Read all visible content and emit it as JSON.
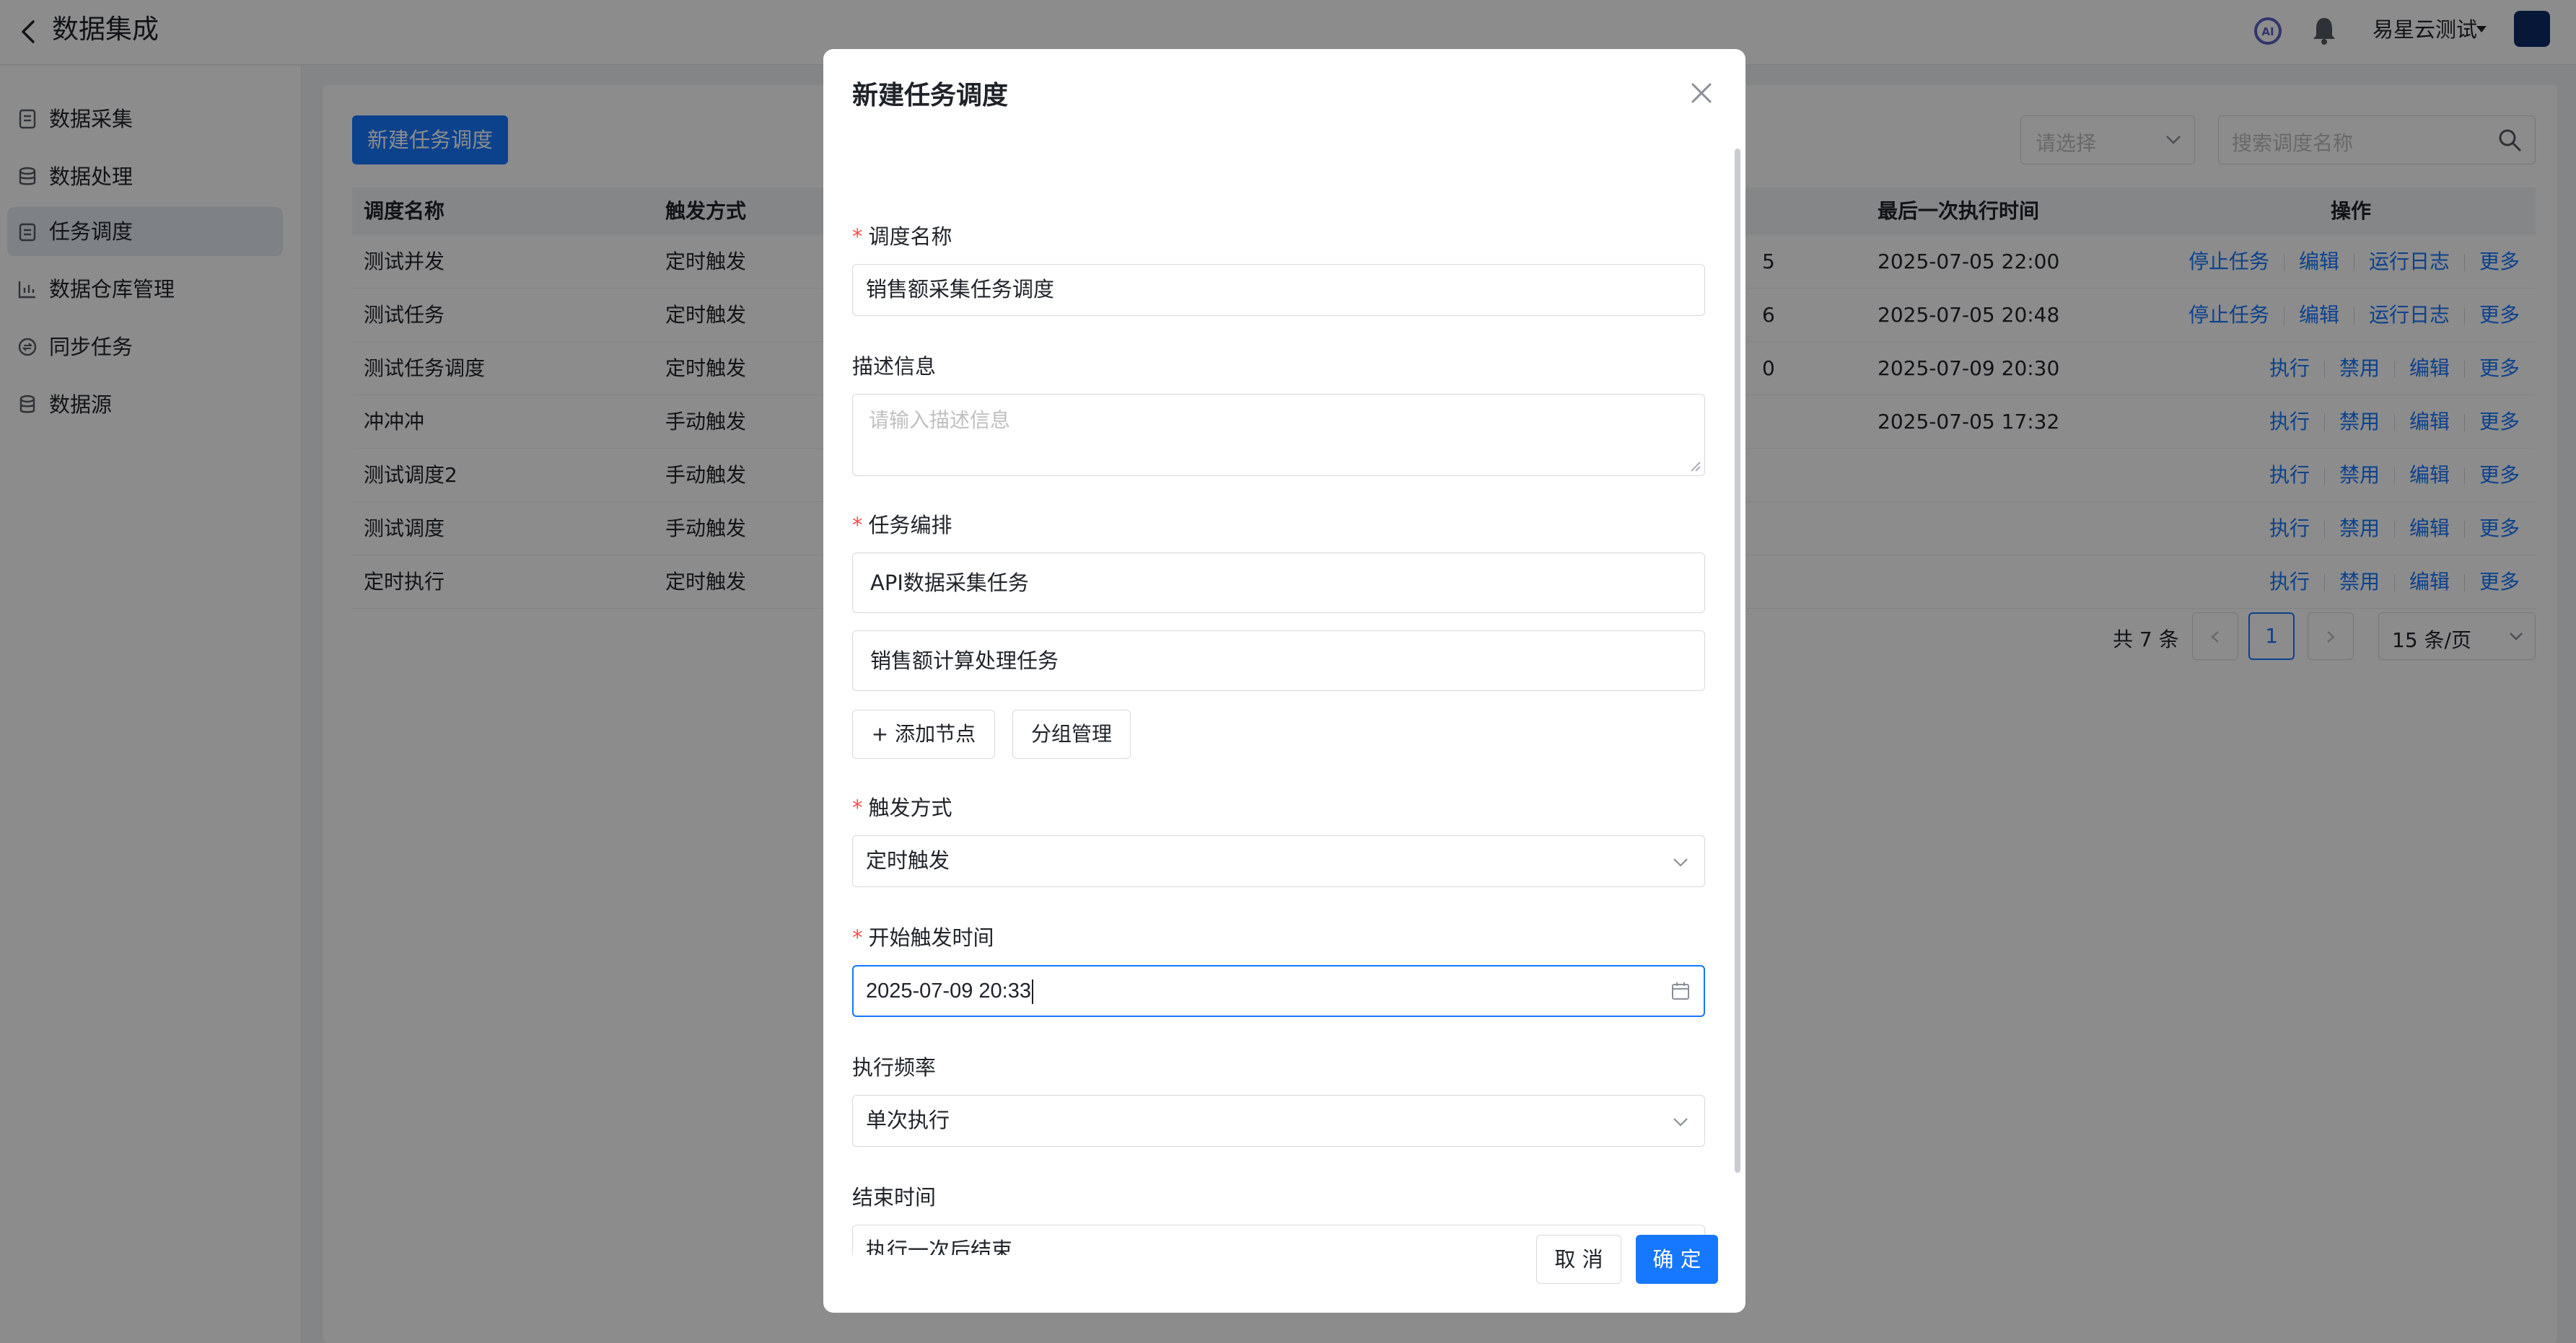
{
  "header": {
    "title": "数据集成",
    "user_name": "易星云测试"
  },
  "sidebar": {
    "items": [
      {
        "label": "数据采集"
      },
      {
        "label": "数据处理"
      },
      {
        "label": "任务调度"
      },
      {
        "label": "数据仓库管理"
      },
      {
        "label": "同步任务"
      },
      {
        "label": "数据源"
      }
    ]
  },
  "main": {
    "new_button": "新建任务调度",
    "filter_placeholder": "请选择",
    "search_placeholder": "搜索调度名称",
    "columns": [
      "调度名称",
      "触发方式",
      "最后一次执行时间",
      "操作"
    ],
    "rows": [
      {
        "name": "测试并发",
        "trigger": "定时触发",
        "partial": "5",
        "last_run": "2025-07-05 22:00",
        "ops": [
          "停止任务",
          "编辑",
          "运行日志",
          "更多"
        ]
      },
      {
        "name": "测试任务",
        "trigger": "定时触发",
        "partial": "6",
        "last_run": "2025-07-05 20:48",
        "ops": [
          "停止任务",
          "编辑",
          "运行日志",
          "更多"
        ]
      },
      {
        "name": "测试任务调度",
        "trigger": "定时触发",
        "partial": "0",
        "last_run": "2025-07-09 20:30",
        "ops": [
          "执行",
          "禁用",
          "编辑",
          "更多"
        ]
      },
      {
        "name": "冲冲冲",
        "trigger": "手动触发",
        "partial": "",
        "last_run": "2025-07-05 17:32",
        "ops": [
          "执行",
          "禁用",
          "编辑",
          "更多"
        ]
      },
      {
        "name": "测试调度2",
        "trigger": "手动触发",
        "partial": "",
        "last_run": "",
        "ops": [
          "执行",
          "禁用",
          "编辑",
          "更多"
        ]
      },
      {
        "name": "测试调度",
        "trigger": "手动触发",
        "partial": "",
        "last_run": "",
        "ops": [
          "执行",
          "禁用",
          "编辑",
          "更多"
        ]
      },
      {
        "name": "定时执行",
        "trigger": "定时触发",
        "partial": "",
        "last_run": "",
        "ops": [
          "执行",
          "禁用",
          "编辑",
          "更多"
        ]
      }
    ],
    "pagination": {
      "total": "共 7 条",
      "current_page": "1",
      "page_size": "15 条/页"
    }
  },
  "modal": {
    "title": "新建任务调度",
    "name_label": "调度名称",
    "name_value": "销售额采集任务调度",
    "desc_label": "描述信息",
    "desc_placeholder": "请输入描述信息",
    "arrange_label": "任务编排",
    "tasks": [
      "API数据采集任务",
      "销售额计算处理任务"
    ],
    "add_node": "添加节点",
    "group_manage": "分组管理",
    "trigger_label": "触发方式",
    "trigger_value": "定时触发",
    "start_label": "开始触发时间",
    "start_value": "2025-07-09 20:33",
    "freq_label": "执行频率",
    "freq_value": "单次执行",
    "end_label": "结束时间",
    "end_value": "执行一次后结束",
    "cancel": "取 消",
    "ok": "确 定"
  },
  "colors": {
    "primary": "#1677ff",
    "required": "#ff4d4f",
    "avatar": "#0b2a66"
  }
}
